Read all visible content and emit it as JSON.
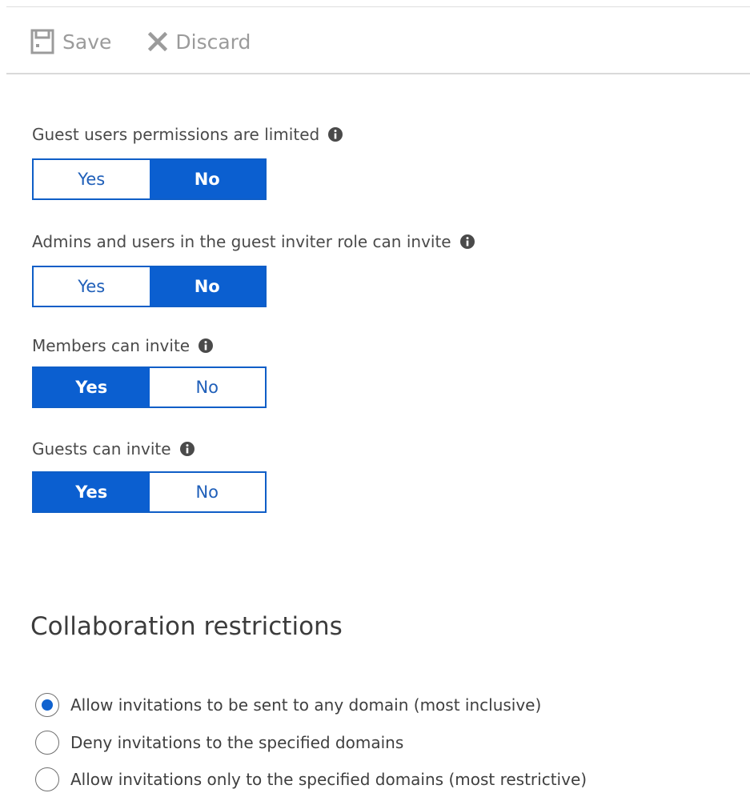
{
  "toolbar": {
    "save_label": "Save",
    "discard_label": "Discard"
  },
  "icons": {
    "save": "save-icon",
    "discard": "discard-x-icon",
    "info": "info-icon"
  },
  "colors": {
    "accent": "#0b5fd0",
    "command_text": "#9b9b9b",
    "label_text": "#4a4a4a"
  },
  "settings": [
    {
      "label": "Guest users permissions are limited",
      "yes": "Yes",
      "no": "No",
      "selected": "No"
    },
    {
      "label": "Admins and users in the guest inviter role can invite",
      "yes": "Yes",
      "no": "No",
      "selected": "No"
    },
    {
      "label": "Members can invite",
      "yes": "Yes",
      "no": "No",
      "selected": "Yes"
    },
    {
      "label": "Guests can invite",
      "yes": "Yes",
      "no": "No",
      "selected": "Yes"
    }
  ],
  "collaboration": {
    "title": "Collaboration restrictions",
    "options": [
      {
        "label": "Allow invitations to be sent to any domain (most inclusive)",
        "selected": true
      },
      {
        "label": "Deny invitations to the specified domains",
        "selected": false
      },
      {
        "label": "Allow invitations only to the specified domains (most restrictive)",
        "selected": false
      }
    ]
  }
}
